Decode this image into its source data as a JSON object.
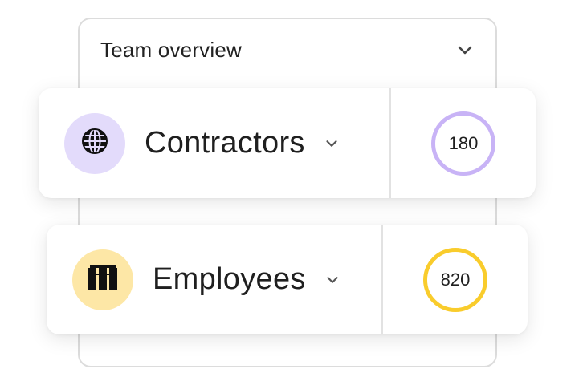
{
  "panel": {
    "title": "Team overview",
    "toggle_icon": "chevron-down-icon"
  },
  "groups": [
    {
      "label": "Contractors",
      "icon": "globe-icon",
      "icon_bg": "#e3dbfb",
      "count": "180",
      "ring_color": "#c8b3f6"
    },
    {
      "label": "Employees",
      "icon": "building-icon",
      "icon_bg": "#fde7a6",
      "count": "820",
      "ring_color": "#f9cc2c"
    }
  ]
}
